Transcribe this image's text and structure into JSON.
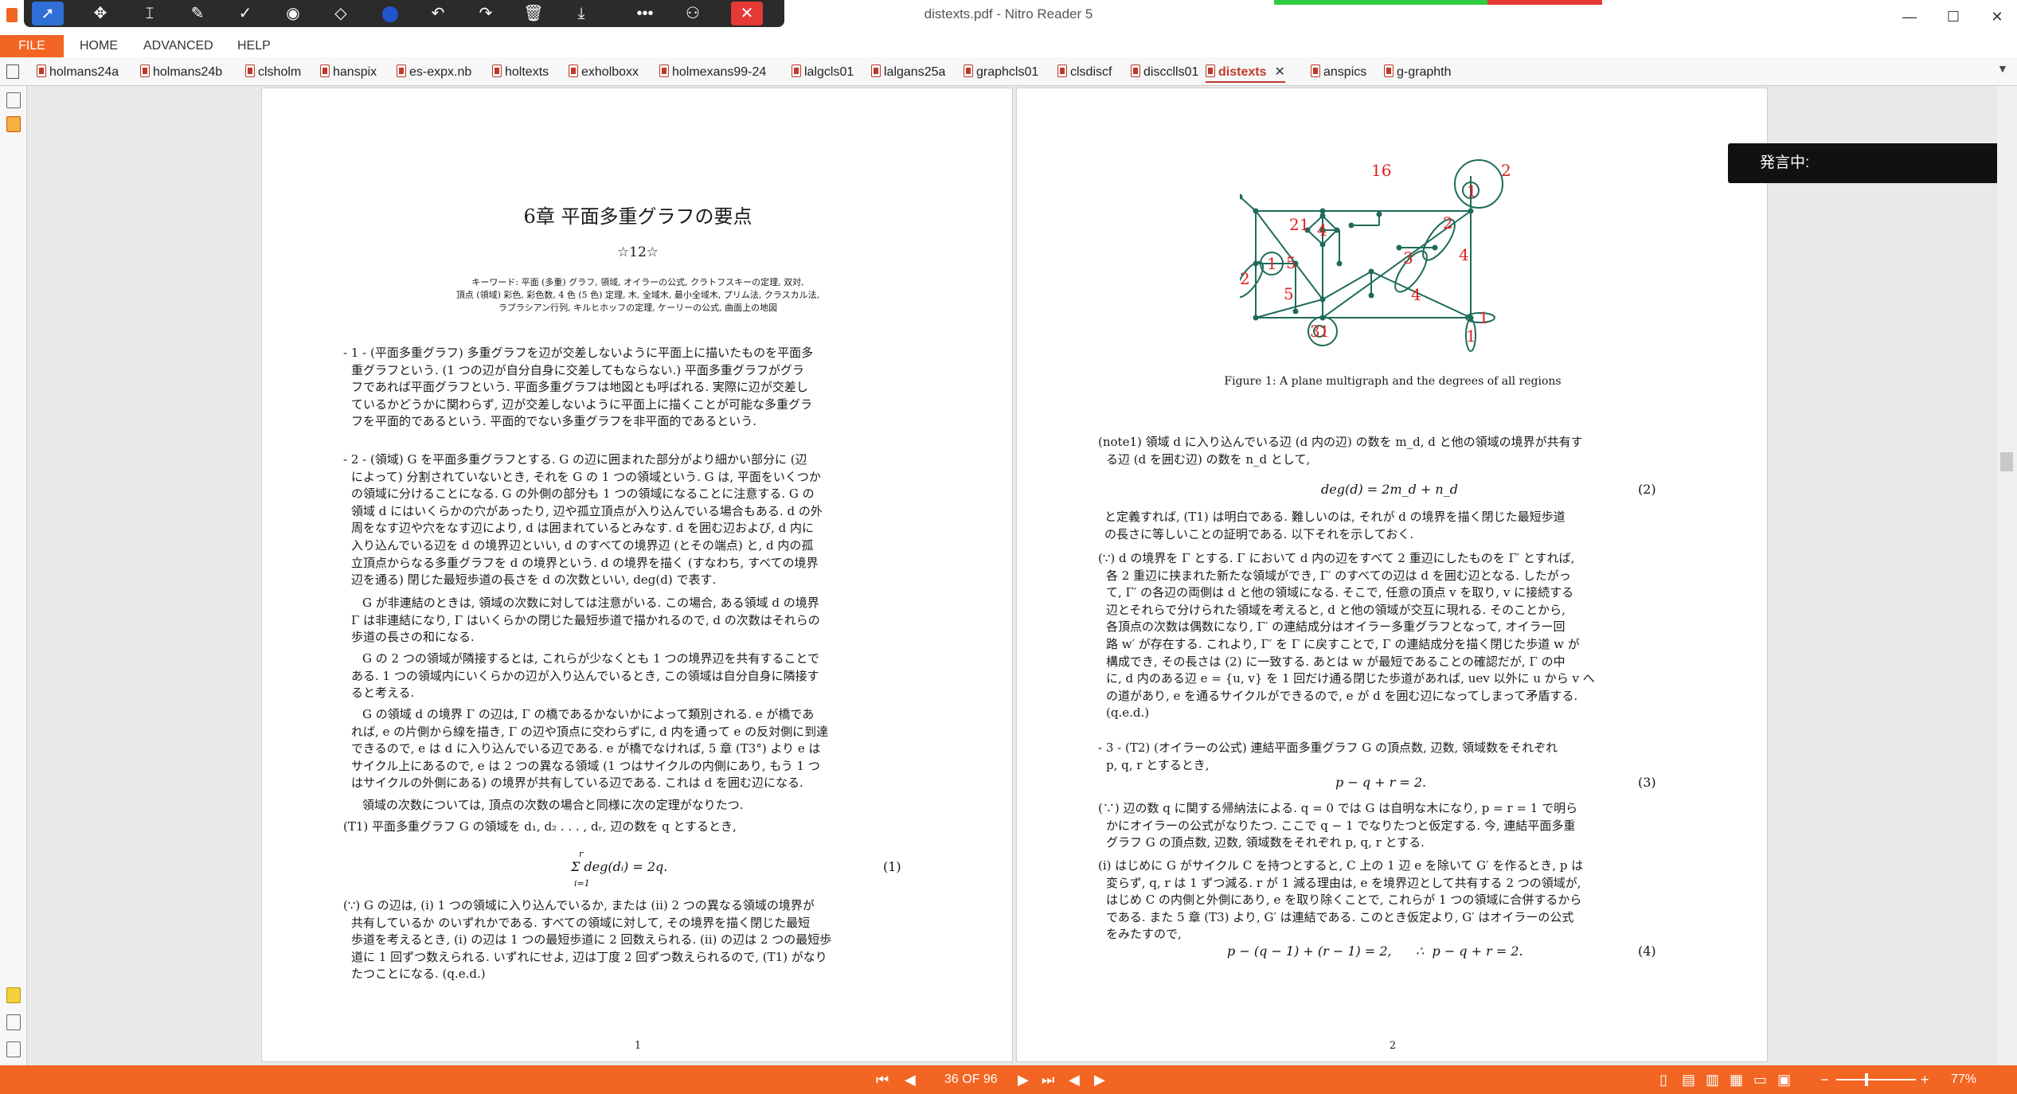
{
  "window": {
    "title": "distexts.pdf - Nitro Reader 5",
    "minimize": "—",
    "maximize": "☐",
    "close": "✕"
  },
  "menu": {
    "items": [
      "FILE",
      "HOME",
      "ADVANCED",
      "HELP"
    ]
  },
  "tabs": [
    {
      "label": "holmans24a"
    },
    {
      "label": "holmans24b"
    },
    {
      "label": "clsholm"
    },
    {
      "label": "hanspix"
    },
    {
      "label": "es-expx.nb"
    },
    {
      "label": "holtexts"
    },
    {
      "label": "exholboxx"
    },
    {
      "label": "holmexans99-24"
    },
    {
      "label": "lalgcls01"
    },
    {
      "label": "lalgans25a"
    },
    {
      "label": "graphcls01"
    },
    {
      "label": "clsdiscf"
    },
    {
      "label": "discclls01"
    },
    {
      "label": "distexts",
      "active": true
    },
    {
      "label": "anspics"
    },
    {
      "label": "g-graphth"
    }
  ],
  "overlay": {
    "speaking": "発言中:"
  },
  "status": {
    "page_indicator": "36 OF 96",
    "zoom": "77%"
  },
  "page1": {
    "chapter_title": "6章 平面多重グラフの要点",
    "star_line": "☆12☆",
    "keywords": [
      "キーワード: 平面 (多重) グラフ, 領域, オイラーの公式, クラトフスキーの定理, 双対,",
      "頂点 (領域) 彩色, 彩色数, 4 色 (5 色) 定理, 木, 全域木, 最小全域木, プリム法, クラスカル法,",
      "ラプラシアン行列, キルヒホッフの定理, ケーリーの公式, 曲面上の地図"
    ],
    "p1": [
      "- 1 - (平面多重グラフ) 多重グラフを辺が交差しないように平面上に描いたものを平面多",
      "重グラフという. (1 つの辺が自分自身に交差してもならない.) 平面多重グラフがグラ",
      "フであれば平面グラフという. 平面多重グラフは地図とも呼ばれる. 実際に辺が交差し",
      "ているかどうかに関わらず, 辺が交差しないように平面上に描くことが可能な多重グラ",
      "フを平面的であるという. 平面的でない多重グラフを非平面的であるという."
    ],
    "p2": [
      "- 2 - (領域) G を平面多重グラフとする. G の辺に囲まれた部分がより細かい部分に (辺",
      "によって) 分割されていないとき, それを G の 1 つの領域という. G は, 平面をいくつか",
      "の領域に分けることになる. G の外側の部分も 1 つの領域になることに注意する. G の",
      "領域 d にはいくらかの穴があったり, 辺や孤立頂点が入り込んでいる場合もある. d の外",
      "周をなす辺や穴をなす辺により, d は囲まれているとみなす. d を囲む辺および, d 内に",
      "入り込んでいる辺を d の境界辺といい, d のすべての境界辺 (とその端点) と, d 内の孤",
      "立頂点からなる多重グラフを d の境界という. d の境界を描く (すなわち, すべての境界",
      "辺を通る) 閉じた最短歩道の長さを d の次数といい, deg(d) で表す."
    ],
    "p3": [
      "G が非連結のときは, 領域の次数に対しては注意がいる. この場合, ある領域 d の境界",
      "Γ は非連結になり, Γ はいくらかの閉じた最短歩道で描かれるので, d の次数はそれらの",
      "歩道の長さの和になる."
    ],
    "p4": [
      "G の 2 つの領域が隣接するとは, これらが少なくとも 1 つの境界辺を共有することで",
      "ある. 1 つの領域内にいくらかの辺が入り込んでいるとき, この領域は自分自身に隣接す",
      "ると考える."
    ],
    "p5": [
      "G の領域 d の境界 Γ の辺は, Γ の橋であるかないかによって類別される. e が橋であ",
      "れば, e の片側から線を描き, Γ の辺や頂点に交わらずに, d 内を通って e の反対側に到達",
      "できるので, e は d に入り込んでいる辺である. e が橋でなければ, 5 章 (T3°) より e は",
      "サイクル上にあるので, e は 2 つの異なる領域 (1 つはサイクルの内側にあり, もう 1 つ",
      "はサイクルの外側にある) の境界が共有している辺である. これは d を囲む辺になる."
    ],
    "p6": "領域の次数については, 頂点の次数の場合と同様に次の定理がなりたつ.",
    "p7": "(T1) 平面多重グラフ G の領域を d₁, d₂ . . . , dᵣ, 辺の数を q とするとき,",
    "eq1": "Σ deg(dᵢ) = 2q.",
    "eq1_upper": "r",
    "eq1_lower": "i=1",
    "eq1_num": "(1)",
    "p8": [
      "(∵) G の辺は, (i) 1 つの領域に入り込んでいるか, または (ii) 2 つの異なる領域の境界が",
      "共有しているか のいずれかである. すべての領域に対して, その境界を描く閉じた最短",
      "歩道を考えるとき, (i) の辺は 1 つの最短歩道に 2 回数えられる. (ii) の辺は 2 つの最短歩",
      "道に 1 回ずつ数えられる. いずれにせよ, 辺は丁度 2 回ずつ数えられるので, (T1) がなり",
      "たつことになる. (q.e.d.)"
    ],
    "page_num": "1"
  },
  "page2": {
    "figure": {
      "caption": "Figure 1: A plane multigraph and the degrees of all regions",
      "labels": [
        "16",
        "2",
        "1",
        "21",
        "4",
        "2",
        "4",
        "1",
        "5",
        "3",
        "2",
        "5",
        "4",
        "1",
        "3",
        "1",
        "1"
      ]
    },
    "note1": [
      "(note1) 領域 d に入り込んでいる辺 (d 内の辺) の数を m_d, d と他の領域の境界が共有す",
      "る辺 (d を囲む辺) の数を n_d として,"
    ],
    "eq2": "deg(d) = 2m_d + n_d",
    "eq2_num": "(2)",
    "p_after2": [
      "と定義すれば, (T1) は明白である. 難しいのは, それが d の境界を描く閉じた最短歩道",
      "の長さに等しいことの証明である. 以下それを示しておく."
    ],
    "proof": [
      "(∵) d の境界を Γ とする. Γ において d 内の辺をすべて 2 重辺にしたものを Γ′ とすれば,",
      "各 2 重辺に挟まれた新たな領域ができ, Γ′ のすべての辺は d を囲む辺となる. したがっ",
      "て, Γ′ の各辺の両側は d と他の領域になる. そこで, 任意の頂点 v を取り, v に接続する",
      "辺とそれらで分けられた領域を考えると, d と他の領域が交互に現れる. そのことから,",
      "各頂点の次数は偶数になり, Γ′ の連結成分はオイラー多重グラフとなって, オイラー回",
      "路 w′ が存在する. これより, Γ′ を Γ に戻すことで, Γ の連結成分を描く閉じた歩道 w が",
      "構成でき, その長さは (2) に一致する. あとは w が最短であることの確認だが, Γ の中",
      "に, d 内のある辺 e = {u, v} を 1 回だけ通る閉じた歩道があれば, uev 以外に u から v へ",
      "の道があり, e を通るサイクルができるので, e が d を囲む辺になってしまって矛盾する.",
      "(q.e.d.)"
    ],
    "p3": [
      "- 3 - (T2) (オイラーの公式) 連結平面多重グラフ G の頂点数, 辺数, 領域数をそれぞれ",
      "p, q, r とするとき,"
    ],
    "eq3": "p − q + r = 2.",
    "eq3_num": "(3)",
    "p4": [
      "(∵) 辺の数 q に関する帰納法による. q = 0 では G は自明な木になり, p = r = 1 で明ら",
      "かにオイラーの公式がなりたつ. ここで q − 1 でなりたつと仮定する. 今, 連結平面多重",
      "グラフ G の頂点数, 辺数, 領域数をそれぞれ p, q, r とする."
    ],
    "p5": [
      "(i) はじめに G がサイクル C を持つとすると, C 上の 1 辺 e を除いて G′ を作るとき, p は",
      "変らず, q, r は 1 ずつ減る. r が 1 減る理由は, e を境界辺として共有する 2 つの領域が,",
      "はじめ C の内側と外側にあり, e を取り除くことで, これらが 1 つの領域に合併するから",
      "である. また 5 章 (T3) より, G′ は連結である. このとき仮定より, G′ はオイラーの公式",
      "をみたすので,"
    ],
    "eq4": "p − (q − 1) + (r − 1) = 2,      ∴  p − q + r = 2.",
    "eq4_num": "(4)",
    "page_num": "2"
  }
}
